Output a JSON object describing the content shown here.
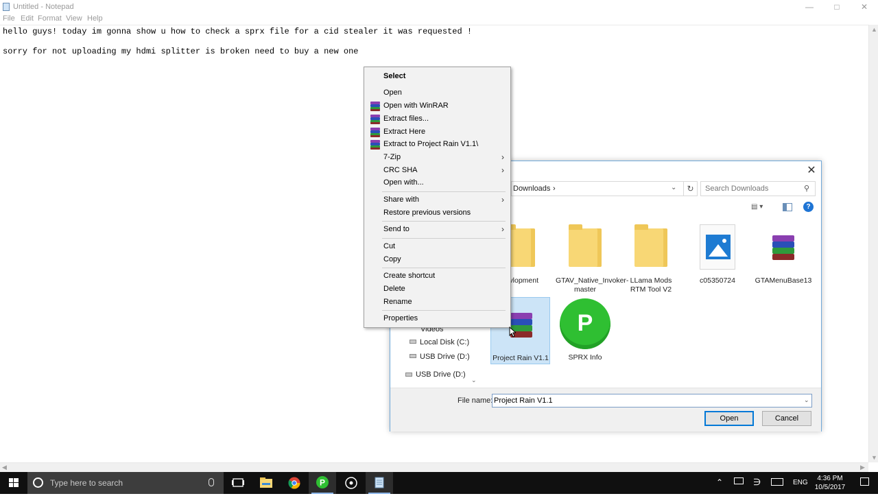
{
  "notepad": {
    "title": "Untitled - Notepad",
    "menu": [
      "File",
      "Edit",
      "Format",
      "View",
      "Help"
    ],
    "lines": [
      "hello guys! today im gonna show u how to check a sprx file for a cid stealer it was requested !",
      "",
      "sorry for not uploading my hdmi splitter is broken need to buy a new one"
    ]
  },
  "dialog": {
    "path": "Downloads",
    "search_placeholder": "Search Downloads",
    "nav_items": [
      "Videos",
      "Local Disk (C:)",
      "USB Drive (D:)",
      "USB Drive (D:)"
    ],
    "files": [
      {
        "label": "Devlopment",
        "icon": "folder-icon"
      },
      {
        "label": "GTAV_Native_Invoker-master",
        "icon": "folder-icon"
      },
      {
        "label": "LLama Mods RTM Tool V2",
        "icon": "folder-icon"
      },
      {
        "label": "c05350724",
        "icon": "image-file-icon"
      },
      {
        "label": "GTAMenuBase13",
        "icon": "winrar-archive-icon"
      },
      {
        "label": "Project Rain V1.1",
        "icon": "winrar-archive-icon"
      },
      {
        "label": "SPRX Info",
        "icon": "playstation-icon"
      }
    ],
    "file_name_label": "File name:",
    "file_name_value": "Project Rain V1.1",
    "open_label": "Open",
    "cancel_label": "Cancel"
  },
  "context_menu": {
    "items": [
      {
        "label": "Select",
        "bold": true
      },
      {
        "label": "Open"
      },
      {
        "label": "Open with WinRAR",
        "icon": "winrar-icon"
      },
      {
        "label": "Extract files...",
        "icon": "winrar-icon"
      },
      {
        "label": "Extract Here",
        "icon": "winrar-icon"
      },
      {
        "label": "Extract to Project Rain V1.1\\",
        "icon": "winrar-icon"
      },
      {
        "label": "7-Zip",
        "submenu": true
      },
      {
        "label": "CRC SHA",
        "submenu": true
      },
      {
        "label": "Open with..."
      },
      {
        "label": "Share with",
        "submenu": true
      },
      {
        "label": "Restore previous versions"
      },
      {
        "label": "Send to",
        "submenu": true
      },
      {
        "label": "Cut"
      },
      {
        "label": "Copy"
      },
      {
        "label": "Create shortcut"
      },
      {
        "label": "Delete"
      },
      {
        "label": "Rename"
      },
      {
        "label": "Properties"
      }
    ]
  },
  "taskbar": {
    "search_placeholder": "Type here to search",
    "language": "ENG",
    "time": "4:36 PM",
    "date": "10/5/2017"
  },
  "colors": {
    "taskbar": "#101010",
    "accent": "#0078d7",
    "menu_bg": "#f2f2f2"
  }
}
